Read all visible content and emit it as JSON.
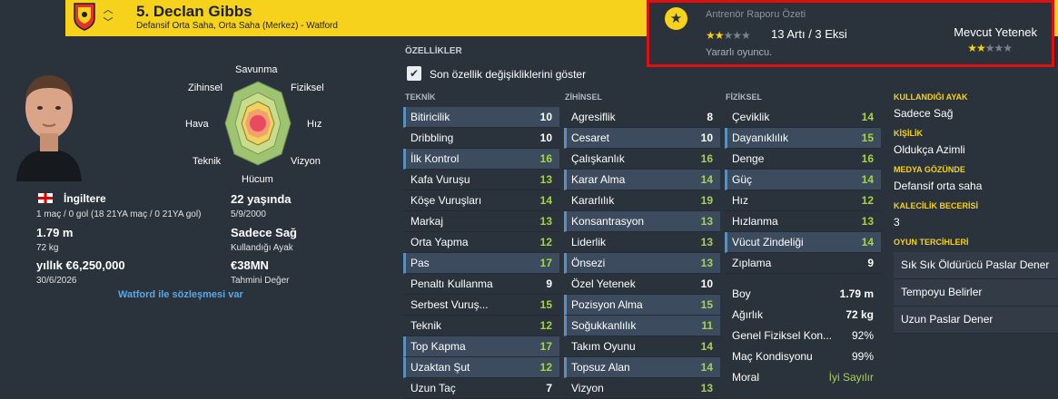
{
  "header": {
    "name": "5. Declan Gibbs",
    "position": "Defansif Orta Saha, Orta Saha (Merkez) - Watford"
  },
  "report": {
    "title": "Antrenör Raporu Özeti",
    "count": "13 Artı / 3 Eksi",
    "summary": "Yararlı oyuncu.",
    "current_label": "Mevcut Yetenek",
    "stars": "2 of 5",
    "current_stars": "2 of 5"
  },
  "radar": {
    "defending": "Savunma",
    "physical": "Fiziksel",
    "speed": "Hız",
    "vision": "Vizyon",
    "attacking": "Hücum",
    "technique": "Teknik",
    "aerial": "Hava",
    "mental": "Zihinsel"
  },
  "profile": {
    "nation": "İngiltere",
    "caps": "1 maç / 0 gol (18 21YA maç / 0 21YA gol)",
    "age": "22 yaşında",
    "dob": "5/9/2000",
    "height": "1.79 m",
    "weight": "72 kg",
    "foot": "Sadece Sağ",
    "foot_label": "Kullandığı Ayak",
    "wage": "yıllık €6,250,000",
    "contract_end": "30/6/2026",
    "value": "€38MN",
    "value_label": "Tahmini Değer",
    "contract": "Watford ile sözleşmesi var"
  },
  "attributes": {
    "title": "ÖZELLİKLER",
    "toggle": "Son özellik değişikliklerini göster",
    "technical_title": "TEKNİK",
    "mental_title": "ZİHİNSEL",
    "physical_title": "FİZİKSEL",
    "technical": [
      {
        "n": "Bitiricilik",
        "v": "10"
      },
      {
        "n": "Dribbling",
        "v": "10"
      },
      {
        "n": "İlk Kontrol",
        "v": "16"
      },
      {
        "n": "Kafa Vuruşu",
        "v": "13"
      },
      {
        "n": "Köşe Vuruşları",
        "v": "14"
      },
      {
        "n": "Markaj",
        "v": "13"
      },
      {
        "n": "Orta Yapma",
        "v": "12"
      },
      {
        "n": "Pas",
        "v": "17"
      },
      {
        "n": "Penaltı Kullanma",
        "v": "9"
      },
      {
        "n": "Serbest Vuruş...",
        "v": "15"
      },
      {
        "n": "Teknik",
        "v": "12"
      },
      {
        "n": "Top Kapma",
        "v": "17"
      },
      {
        "n": "Uzaktan Şut",
        "v": "12"
      },
      {
        "n": "Uzun Taç",
        "v": "7"
      }
    ],
    "mental": [
      {
        "n": "Agresiflik",
        "v": "8"
      },
      {
        "n": "Cesaret",
        "v": "10"
      },
      {
        "n": "Çalışkanlık",
        "v": "16"
      },
      {
        "n": "Karar Alma",
        "v": "14"
      },
      {
        "n": "Kararlılık",
        "v": "19"
      },
      {
        "n": "Konsantrasyon",
        "v": "13"
      },
      {
        "n": "Liderlik",
        "v": "13"
      },
      {
        "n": "Önsezi",
        "v": "13"
      },
      {
        "n": "Özel Yetenek",
        "v": "10"
      },
      {
        "n": "Pozisyon Alma",
        "v": "15"
      },
      {
        "n": "Soğukkanlılık",
        "v": "11"
      },
      {
        "n": "Takım Oyunu",
        "v": "14"
      },
      {
        "n": "Topsuz Alan",
        "v": "14"
      },
      {
        "n": "Vizyon",
        "v": "13"
      }
    ],
    "physical": [
      {
        "n": "Çeviklik",
        "v": "14"
      },
      {
        "n": "Dayanıklılık",
        "v": "15"
      },
      {
        "n": "Denge",
        "v": "16"
      },
      {
        "n": "Güç",
        "v": "14"
      },
      {
        "n": "Hız",
        "v": "12"
      },
      {
        "n": "Hızlanma",
        "v": "13"
      },
      {
        "n": "Vücut Zindeliği",
        "v": "14"
      },
      {
        "n": "Zıplama",
        "v": "9"
      }
    ],
    "extra": [
      {
        "n": "Boy",
        "v": "1.79 m"
      },
      {
        "n": "Ağırlık",
        "v": "72 kg"
      },
      {
        "n": "Genel Fiziksel Kon...",
        "v": "92%"
      },
      {
        "n": "Maç Kondisyonu",
        "v": "99%"
      },
      {
        "n": "Moral",
        "v": "İyi Sayılır"
      }
    ]
  },
  "side": {
    "foot_h": "KULLANDIĞI AYAK",
    "foot_v": "Sadece Sağ",
    "pers_h": "KİŞİLİK",
    "pers_v": "Oldukça Azimli",
    "media_h": "MEDYA GÖZÜNDE",
    "media_v": "Defansif orta saha",
    "gk_h": "KALECİLİK BECERİSİ",
    "gk_v": "3",
    "pref_h": "OYUN TERCİHLERİ",
    "prefs": [
      "Sık Sık Öldürücü Paslar Dener",
      "Tempoyu Belirler",
      "Uzun Paslar Dener"
    ]
  }
}
